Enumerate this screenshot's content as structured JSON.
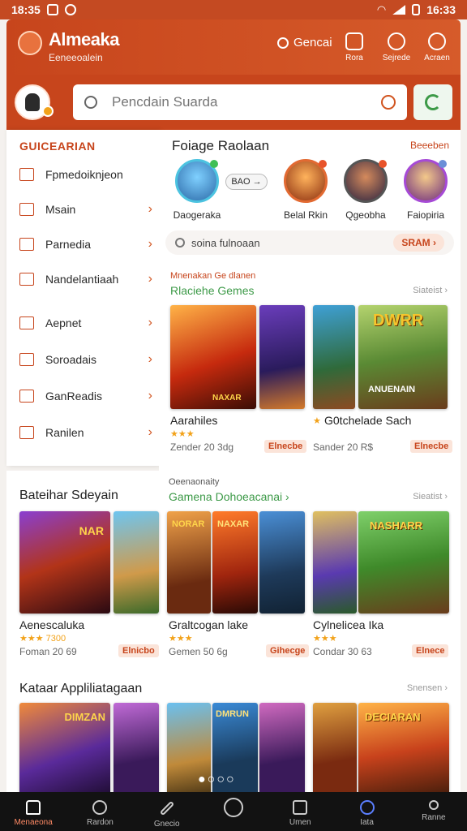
{
  "status": {
    "time": "18:35",
    "clock": "16:33"
  },
  "header": {
    "brand": "Almeaka",
    "subtitle": "Eeneeoalein",
    "search_label": "Gencai",
    "buttons": [
      "Rora",
      "Sejrede",
      "Acraen"
    ]
  },
  "search": {
    "placeholder": "Pencdain Suarda"
  },
  "sidebar": {
    "title": "GUICEARIAN",
    "items": [
      {
        "label": "Fpmedoiknjeon",
        "icon": "gamepad-icon",
        "chevron": false
      },
      {
        "label": "Msain",
        "icon": "square-icon",
        "chevron": true
      },
      {
        "label": "Parnedia",
        "icon": "shield-icon",
        "chevron": true
      },
      {
        "label": "Nandelantiaah",
        "icon": "square-icon",
        "chevron": true
      },
      {
        "label": "Aepnet",
        "icon": "square-icon",
        "chevron": true
      },
      {
        "label": "Soroadais",
        "icon": "calendar-icon",
        "chevron": true
      },
      {
        "label": "GanReadis",
        "icon": "bag-icon",
        "chevron": true
      },
      {
        "label": "Ranilen",
        "icon": "square-icon",
        "chevron": true
      }
    ]
  },
  "featured": {
    "title": "Foiage Raolaan",
    "see_all": "Beeeben",
    "pill": "BAO",
    "stories": [
      "Daogeraka",
      "Belal Rkin",
      "Qgeobha",
      "Faiopiria"
    ],
    "search_text": "soina fulnoaan",
    "search_button": "SRAM"
  },
  "grid_section": {
    "kicker": "Mnenakan Ge dlanen",
    "title": "Rlaciehe Gemes",
    "more": "Siateist",
    "cards": [
      {
        "title": "Aarahiles",
        "stars": "★★★",
        "meta": "Zender 20 3dg",
        "tag": "Elnecbe"
      },
      {
        "title": "G0tchelade Sach",
        "stars": "★",
        "meta": "Sander 20 R$",
        "tag": "Elnecbe"
      }
    ],
    "art_labels": [
      "NAXAR",
      "DWRR",
      "ANUENAIN"
    ]
  },
  "section2": {
    "title": "Bateihar Sdeyain",
    "kicker": "Oeenaonaity",
    "sub": "Gamena Dohoeacanai",
    "more": "Sieatist",
    "cards": [
      {
        "title": "Aenescaluka",
        "stars": "★★★ 7300",
        "meta": "Foman 20 69",
        "tag": "Elnicbo"
      },
      {
        "title": "Graltcogan lake",
        "stars": "★★★",
        "meta": "Gemen 50 6g",
        "tag": "Gihecge"
      },
      {
        "title": "Cylnelicea Ika",
        "stars": "★★★",
        "meta": "Condar 30 63",
        "tag": "Elnece"
      }
    ],
    "art_labels": [
      "NAR",
      "NORAR",
      "NAXAR",
      "NASHARR"
    ]
  },
  "section3": {
    "title": "Kataar Appliliatagaan",
    "more": "Snensen",
    "art_labels": [
      "DIMZAN",
      "DMRUN",
      "DECIARAN"
    ]
  },
  "bottom_nav": [
    "Menaeona",
    "Rardon",
    "Gnecio",
    "",
    "Umen",
    "Iata",
    "Ranne"
  ],
  "colors": {
    "brand": "#c7451c",
    "accent_green": "#3d9a48",
    "star": "#f2a21a"
  }
}
